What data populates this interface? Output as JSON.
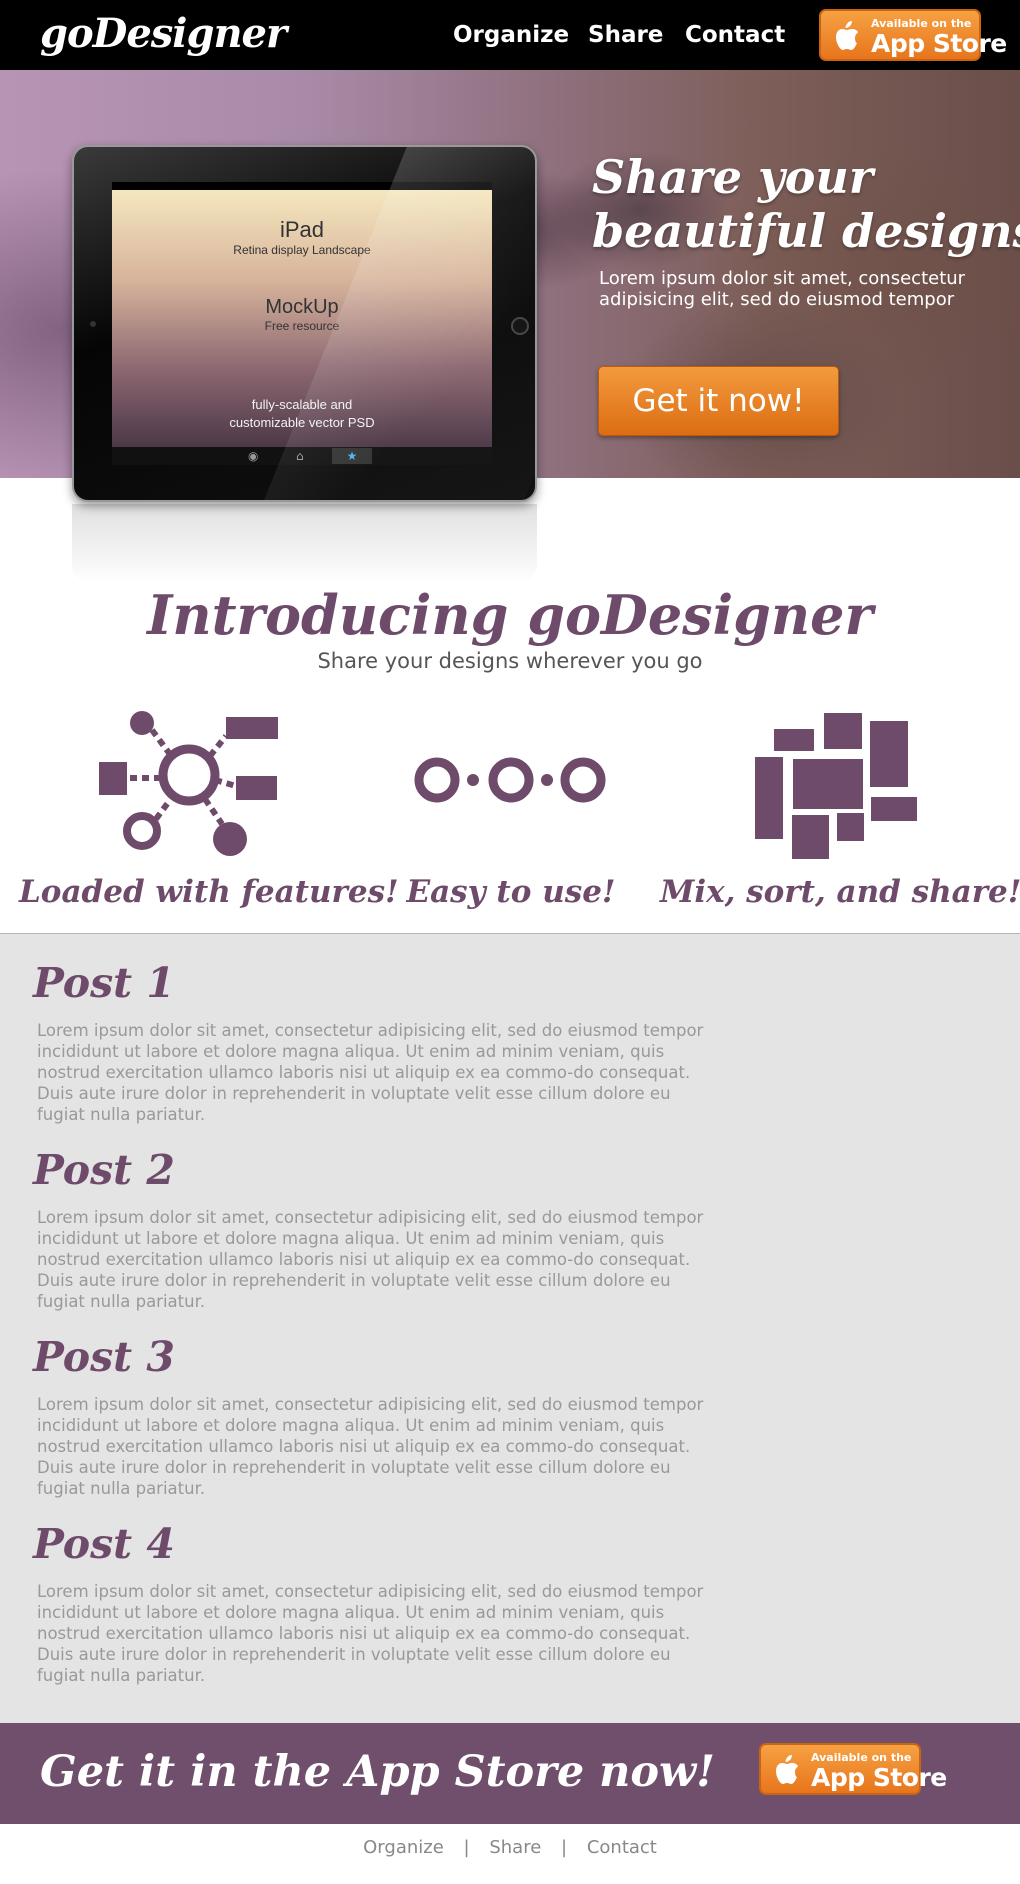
{
  "header": {
    "logo": "goDesigner",
    "nav": [
      "Organize",
      "Share",
      "Contact"
    ],
    "appstore": {
      "small": "Available on the",
      "big": "App Store"
    }
  },
  "hero": {
    "title_line1": "Share your",
    "title_line2": "beautiful designs",
    "text": "Lorem ipsum dolor sit amet, consectetur adipisicing elit, sed do eiusmod tempor",
    "cta": "Get it now!",
    "ipad": {
      "line1": "iPad",
      "line2": "Retina display Landscape",
      "line3": "MockUp",
      "line4": "Free resource",
      "line5": "fully-scalable and",
      "line6": "customizable vector PSD"
    }
  },
  "intro": {
    "title": "Introducing goDesigner",
    "subtitle": "Share your designs wherever you go",
    "features": [
      {
        "label": "Loaded with features!",
        "icon": "network-icon"
      },
      {
        "label": "Easy to use!",
        "icon": "circles-icon"
      },
      {
        "label": "Mix, sort, and share!",
        "icon": "blocks-icon"
      }
    ]
  },
  "posts": [
    {
      "title": "Post 1",
      "body": "Lorem ipsum dolor sit amet, consectetur adipisicing elit, sed do eiusmod tempor incididunt ut labore et dolore magna aliqua. Ut enim ad minim veniam, quis nostrud exercitation ullamco laboris nisi ut aliquip ex ea commo-do consequat. Duis aute irure dolor in reprehenderit in voluptate velit esse cillum dolore eu fugiat nulla pariatur."
    },
    {
      "title": "Post 2",
      "body": "Lorem ipsum dolor sit amet, consectetur adipisicing elit, sed do eiusmod tempor incididunt ut labore et dolore magna aliqua. Ut enim ad minim veniam, quis nostrud exercitation ullamco laboris nisi ut aliquip ex ea commo-do consequat. Duis aute irure dolor in reprehenderit in voluptate velit esse cillum dolore eu fugiat nulla pariatur."
    },
    {
      "title": "Post 3",
      "body": "Lorem ipsum dolor sit amet, consectetur adipisicing elit, sed do eiusmod tempor incididunt ut labore et dolore magna aliqua. Ut enim ad minim veniam, quis nostrud exercitation ullamco laboris nisi ut aliquip ex ea commo-do consequat. Duis aute irure dolor in reprehenderit in voluptate velit esse cillum dolore eu fugiat nulla pariatur."
    },
    {
      "title": "Post 4",
      "body": "Lorem ipsum dolor sit amet, consectetur adipisicing elit, sed do eiusmod tempor incididunt ut labore et dolore magna aliqua. Ut enim ad minim veniam, quis nostrud exercitation ullamco laboris nisi ut aliquip ex ea commo-do consequat. Duis aute irure dolor in reprehenderit in voluptate velit esse cillum dolore eu fugiat nulla pariatur."
    }
  ],
  "banner": {
    "text": "Get it in the App Store now!",
    "appstore": {
      "small": "Available on the",
      "big": "App Store"
    }
  },
  "footer": {
    "nav": [
      "Organize",
      "Share",
      "Contact"
    ],
    "separator": "|"
  },
  "colors": {
    "accent": "#6e4b6a",
    "cta": "#e67b1f",
    "posts_bg": "#e4e4e4",
    "banner": "#6f4f6c"
  }
}
